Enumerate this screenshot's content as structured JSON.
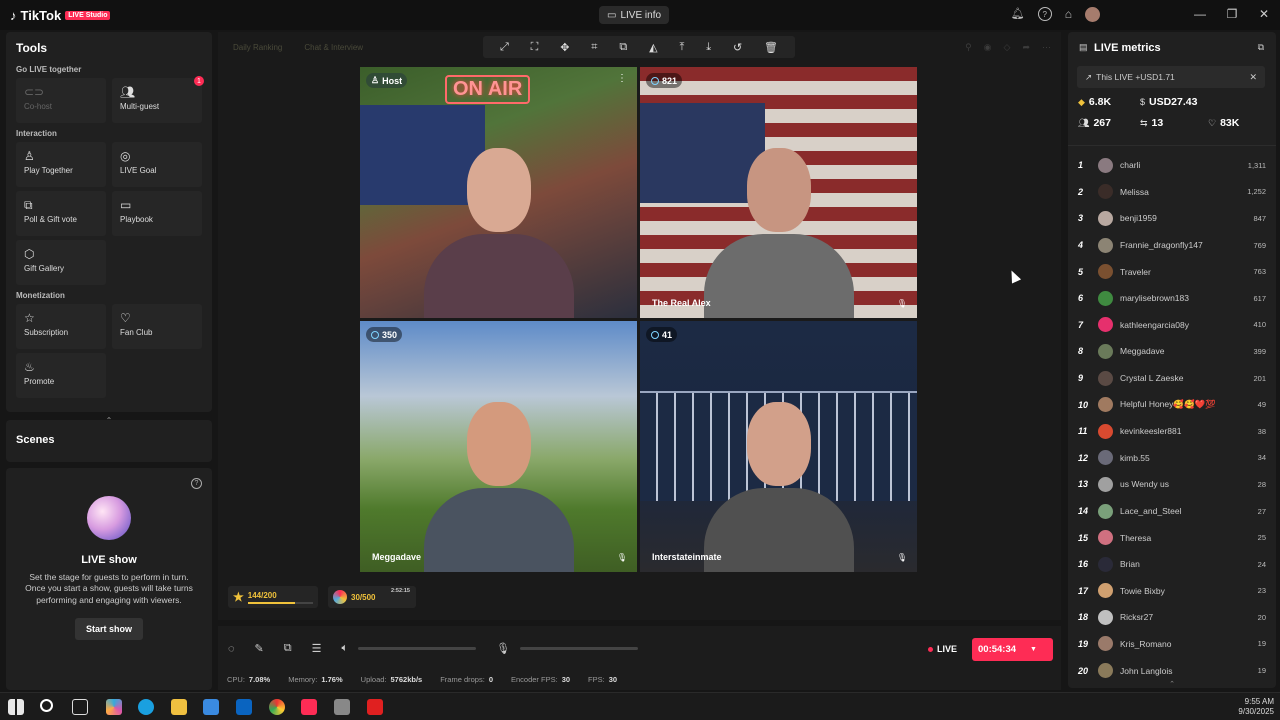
{
  "app": {
    "name": "TikTok",
    "badge": "LIVE Studio",
    "live_info_label": "LIVE info"
  },
  "tools": {
    "title": "Tools",
    "sections": [
      {
        "label": "Go LIVE together",
        "items": [
          {
            "label": "Co-host",
            "icon": "link-icon",
            "disabled": true
          },
          {
            "label": "Multi-guest",
            "icon": "users-icon",
            "badge": "1"
          }
        ]
      },
      {
        "label": "Interaction",
        "items": [
          {
            "label": "Play Together",
            "icon": "person-icon"
          },
          {
            "label": "LIVE Goal",
            "icon": "goal-icon"
          },
          {
            "label": "Poll & Gift vote",
            "icon": "poll-icon"
          },
          {
            "label": "Playbook",
            "icon": "book-icon"
          },
          {
            "label": "Gift Gallery",
            "icon": "gift-icon"
          }
        ]
      },
      {
        "label": "Monetization",
        "items": [
          {
            "label": "Subscription",
            "icon": "star-icon"
          },
          {
            "label": "Fan Club",
            "icon": "heart-icon"
          },
          {
            "label": "Promote",
            "icon": "fire-icon"
          }
        ]
      }
    ]
  },
  "scenes": {
    "title": "Scenes"
  },
  "live_show": {
    "title": "LIVE show",
    "description": "Set the stage for guests to perform in turn. Once you start a show, guests will take turns performing and engaging with viewers.",
    "button": "Start show"
  },
  "ghost_tabs": [
    "Daily Ranking",
    "Chat & Interview"
  ],
  "video_grid": {
    "cells": [
      {
        "chip": "Host",
        "name": "",
        "neon": "ON AIR"
      },
      {
        "chip": "821",
        "name": "The Real Alex"
      },
      {
        "chip": "350",
        "name": "Meggadave"
      },
      {
        "chip": "41",
        "name": "Interstateinmate"
      }
    ]
  },
  "goals": [
    {
      "text": "144/200",
      "time": ""
    },
    {
      "text": "30/500",
      "time": "2:52:15"
    }
  ],
  "live_status": {
    "label": "LIVE",
    "timer": "00:54:34"
  },
  "stats": {
    "cpu_label": "CPU:",
    "cpu": "7.08%",
    "memory_label": "Memory:",
    "memory": "1.76%",
    "upload_label": "Upload:",
    "upload": "5762kb/s",
    "frame_drops_label": "Frame drops:",
    "frame_drops": "0",
    "encoder_label": "Encoder FPS:",
    "encoder_fps": "30",
    "fps_label": "FPS:",
    "fps": "30"
  },
  "metrics": {
    "title": "LIVE metrics",
    "banner": "This LIVE +USD1.71",
    "diamonds": "6.8K",
    "usd": "USD27.43",
    "viewers": "267",
    "shares": "13",
    "likes": "83K"
  },
  "leaderboard": [
    {
      "rank": "1",
      "name": "charli",
      "score": "1,311",
      "color": "#8a7a80"
    },
    {
      "rank": "2",
      "name": "Melissa",
      "score": "1,252",
      "color": "#3a2c28"
    },
    {
      "rank": "3",
      "name": "benji1959",
      "score": "847",
      "color": "#b8a8a0"
    },
    {
      "rank": "4",
      "name": "Frannie_dragonfly147",
      "score": "769",
      "color": "#8c8474"
    },
    {
      "rank": "5",
      "name": "Traveler",
      "score": "763",
      "color": "#7a5030"
    },
    {
      "rank": "6",
      "name": "marylisebrown183",
      "score": "617",
      "color": "#3f8a40"
    },
    {
      "rank": "7",
      "name": "kathleengarcia08y",
      "score": "410",
      "color": "#e6306d"
    },
    {
      "rank": "8",
      "name": "Meggadave",
      "score": "399",
      "color": "#6a7a5a"
    },
    {
      "rank": "9",
      "name": "Crystal L Zaeske",
      "score": "201",
      "color": "#5a4a44"
    },
    {
      "rank": "10",
      "name": "Helpful Honey🥰🥰❤️💯",
      "score": "49",
      "color": "#a07a60"
    },
    {
      "rank": "11",
      "name": "kevinkeesler881",
      "score": "38",
      "color": "#d84a30"
    },
    {
      "rank": "12",
      "name": "kimb.55",
      "score": "34",
      "color": "#6a6a78"
    },
    {
      "rank": "13",
      "name": "us Wendy us",
      "score": "28",
      "color": "#a0a0a0"
    },
    {
      "rank": "14",
      "name": "Lace_and_Steel",
      "score": "27",
      "color": "#7aa07a"
    },
    {
      "rank": "15",
      "name": "Theresa",
      "score": "25",
      "color": "#d07080"
    },
    {
      "rank": "16",
      "name": "Brian",
      "score": "24",
      "color": "#2a2a38"
    },
    {
      "rank": "17",
      "name": "Towie Bixby",
      "score": "23",
      "color": "#d0a070"
    },
    {
      "rank": "18",
      "name": "Ricksr27",
      "score": "20",
      "color": "#c0c0c0"
    },
    {
      "rank": "19",
      "name": "Kris_Romano",
      "score": "19",
      "color": "#9a7a6a"
    },
    {
      "rank": "20",
      "name": "John Langlois",
      "score": "19",
      "color": "#8a7a5a"
    }
  ],
  "clock": {
    "time": "9:55 AM",
    "date": "9/30/2025"
  },
  "colors": {
    "accent": "#fe2c55",
    "goal": "#f0c23b",
    "panel": "#202020"
  }
}
